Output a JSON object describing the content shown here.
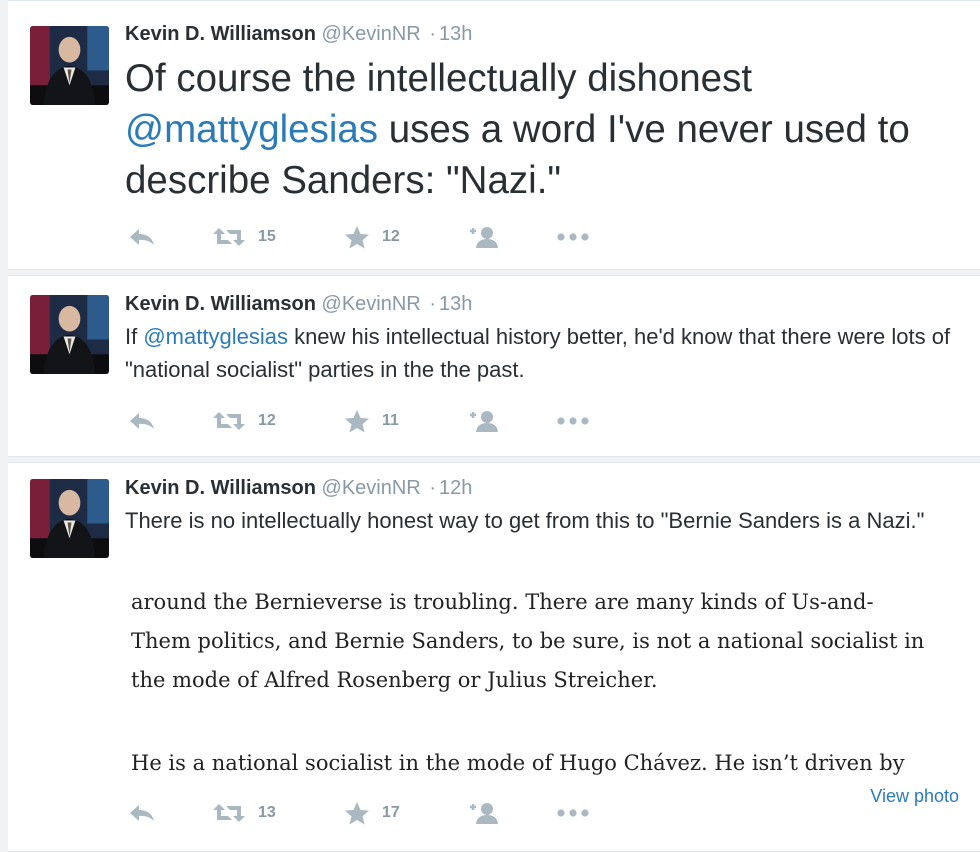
{
  "tweets": [
    {
      "fullname": "Kevin D. Williamson",
      "handle": "@KevinNR",
      "separator": "·",
      "time": "13h",
      "text_parts": [
        "Of course the intellectually dishonest ",
        "@mattyglesias",
        " uses a word I've never used to describe Sanders: \"Nazi.\""
      ],
      "retweets": "15",
      "favorites": "12"
    },
    {
      "fullname": "Kevin D. Williamson",
      "handle": "@KevinNR",
      "separator": "·",
      "time": "13h",
      "text_parts": [
        "If ",
        "@mattyglesias",
        " knew his intellectual history better, he'd know that there were lots of \"national socialist\" parties in the the past."
      ],
      "retweets": "12",
      "favorites": "11"
    },
    {
      "fullname": "Kevin D. Williamson",
      "handle": "@KevinNR",
      "separator": "·",
      "time": "12h",
      "text": "There is no intellectually honest way to get from this to \"Bernie Sanders is a Nazi.\"",
      "photo_lines": [
        "around the Bernieverse is troubling. There are many kinds of Us-and-",
        "Them politics, and Bernie Sanders, to be sure, is not a national socialist in",
        "the mode of Alfred Rosenberg or Julius Streicher.",
        "He is a national socialist in the mode of Hugo Chávez. He isn’t driven by"
      ],
      "view_photo_label": "View photo",
      "retweets": "13",
      "favorites": "17"
    }
  ],
  "icons": [
    "reply-icon",
    "retweet-icon",
    "favorite-star-icon",
    "follow-icon",
    "more-icon"
  ],
  "colors": {
    "link": "#2b7bb9",
    "muted": "#8899a6",
    "icon": "#aab8c2",
    "text": "#292f33"
  }
}
